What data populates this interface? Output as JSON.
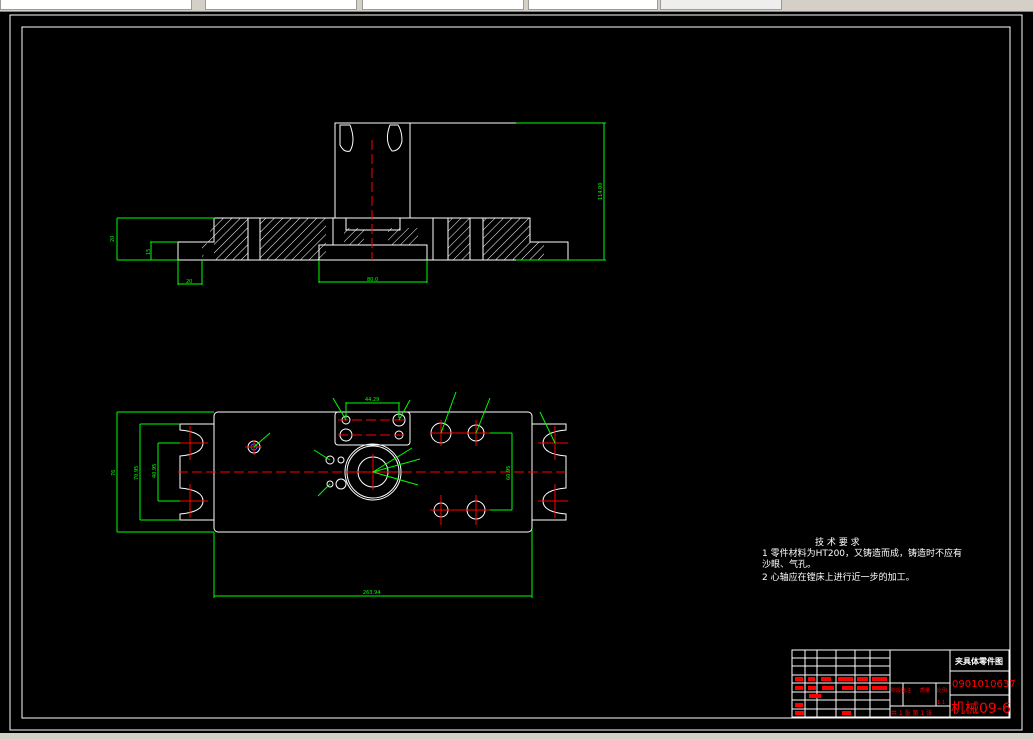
{
  "drawing": {
    "top_view_dims": [
      "20",
      "15",
      "20",
      "80.0",
      "114.00"
    ],
    "front_view_dims": [
      "263.94",
      "76",
      "70.95",
      "40.95",
      "60.95",
      "44.29"
    ],
    "tech_requirements": {
      "title": "技 术 要 求",
      "line1": "1 零件材料为HT200，又铸造而成，铸造时不应有",
      "line2": "沙眼、气孔。",
      "line3": "2 心轴应在镗床上进行近一步的加工。"
    },
    "title_block": {
      "drawing_name": "夹具体零件图",
      "number": "0901010637",
      "stage_label": "阶段标注",
      "weight_label": "质量",
      "scale_label": "比例",
      "scale_value": "1:1",
      "sheets": "共 1 张  第 1 张",
      "class": "机械09-6"
    }
  },
  "colors": {
    "background": "#000000",
    "outline": "#ffffff",
    "dimension": "#00ff00",
    "centerline": "#ff0000"
  }
}
